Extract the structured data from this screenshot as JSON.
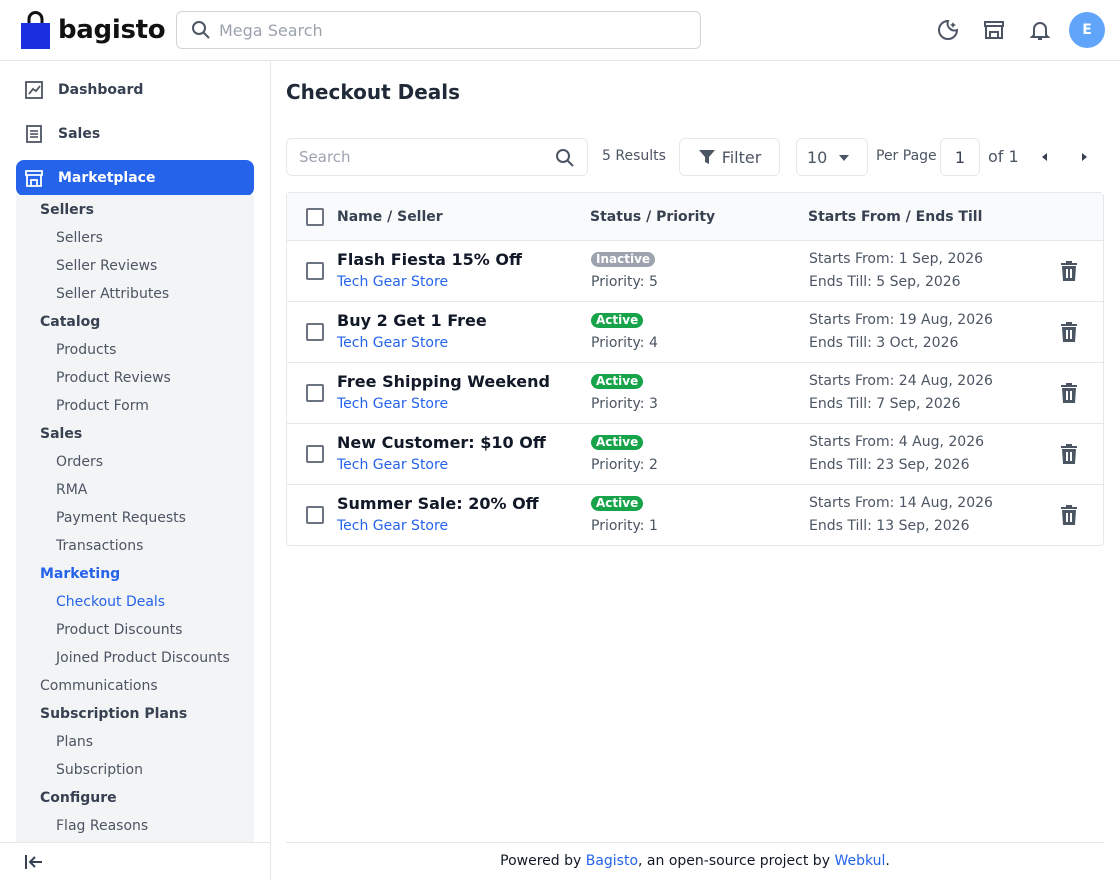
{
  "header": {
    "logo_text": "bagisto",
    "search_placeholder": "Mega Search",
    "avatar_initial": "E",
    "icons": [
      "moon-icon",
      "store-icon",
      "bell-icon"
    ]
  },
  "sidebar": {
    "top_items": [
      {
        "label": "Dashboard",
        "icon": "dashboard-icon"
      },
      {
        "label": "Sales",
        "icon": "sales-icon"
      },
      {
        "label": "Marketplace",
        "icon": "store-icon",
        "active": true
      }
    ],
    "submenu": [
      {
        "label": "Sellers",
        "level": 1
      },
      {
        "label": "Sellers",
        "level": 2
      },
      {
        "label": "Seller Reviews",
        "level": 2
      },
      {
        "label": "Seller Attributes",
        "level": 2
      },
      {
        "label": "Catalog",
        "level": 1
      },
      {
        "label": "Products",
        "level": 2
      },
      {
        "label": "Product Reviews",
        "level": 2
      },
      {
        "label": "Product Form",
        "level": 2
      },
      {
        "label": "Sales",
        "level": 1
      },
      {
        "label": "Orders",
        "level": 2
      },
      {
        "label": "RMA",
        "level": 2
      },
      {
        "label": "Payment Requests",
        "level": 2
      },
      {
        "label": "Transactions",
        "level": 2
      },
      {
        "label": "Marketing",
        "level": 1,
        "active": true
      },
      {
        "label": "Checkout Deals",
        "level": 2,
        "active": true
      },
      {
        "label": "Product Discounts",
        "level": 2
      },
      {
        "label": "Joined Product Discounts",
        "level": 2
      },
      {
        "label": "Communications",
        "level": 1
      },
      {
        "label": "Subscription Plans",
        "level": 1
      },
      {
        "label": "Plans",
        "level": 2
      },
      {
        "label": "Subscription",
        "level": 2
      },
      {
        "label": "Configure",
        "level": 1
      },
      {
        "label": "Flag Reasons",
        "level": 2
      }
    ]
  },
  "main": {
    "title": "Checkout Deals",
    "search_placeholder": "Search",
    "results": "5 Results",
    "filter_label": "Filter",
    "per_page_value": "10",
    "per_page_label": "Per Page",
    "current_page": "1",
    "of_label": "of 1",
    "columns": [
      "Name / Seller",
      "Status / Priority",
      "Starts From / Ends Till"
    ],
    "rows": [
      {
        "name": "Flash Fiesta 15% Off",
        "seller": "Tech Gear Store",
        "status": "Inactive",
        "priority": "Priority: 5",
        "starts": "Starts From: 1 Sep, 2026",
        "ends": "Ends Till: 5 Sep, 2026"
      },
      {
        "name": "Buy 2 Get 1 Free",
        "seller": "Tech Gear Store",
        "status": "Active",
        "priority": "Priority: 4",
        "starts": "Starts From: 19 Aug, 2026",
        "ends": "Ends Till: 3 Oct, 2026"
      },
      {
        "name": "Free Shipping Weekend",
        "seller": "Tech Gear Store",
        "status": "Active",
        "priority": "Priority: 3",
        "starts": "Starts From: 24 Aug, 2026",
        "ends": "Ends Till: 7 Sep, 2026"
      },
      {
        "name": "New Customer: $10 Off",
        "seller": "Tech Gear Store",
        "status": "Active",
        "priority": "Priority: 2",
        "starts": "Starts From: 4 Aug, 2026",
        "ends": "Ends Till: 23 Sep, 2026"
      },
      {
        "name": "Summer Sale: 20% Off",
        "seller": "Tech Gear Store",
        "status": "Active",
        "priority": "Priority: 1",
        "starts": "Starts From: 14 Aug, 2026",
        "ends": "Ends Till: 13 Sep, 2026"
      }
    ]
  },
  "footer": {
    "prefix": "Powered by ",
    "link1": "Bagisto",
    "middle": ", an open-source project by ",
    "link2": "Webkul",
    "suffix": "."
  },
  "colors": {
    "accent": "#2563eb",
    "active_badge": "#16a34a",
    "inactive_badge": "#9ca3af"
  }
}
